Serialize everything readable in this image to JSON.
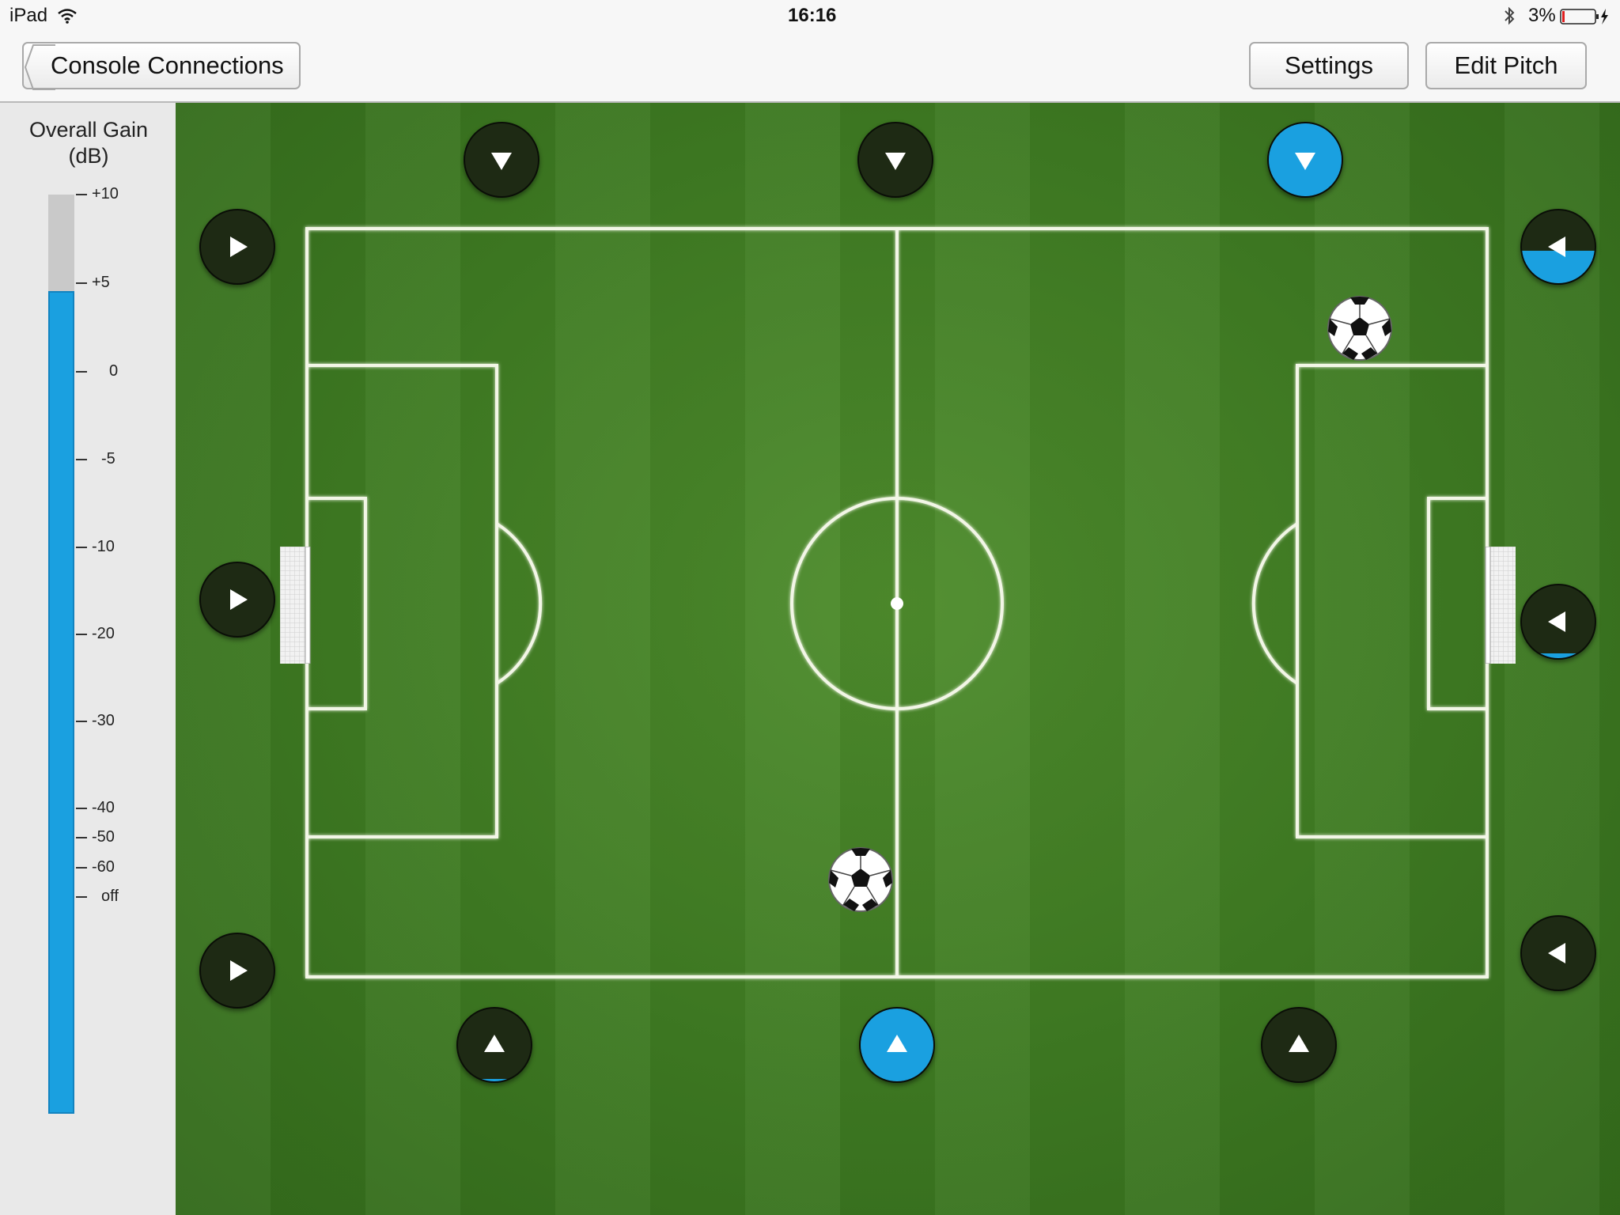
{
  "status_bar": {
    "device": "iPad",
    "time": "16:16",
    "battery": "3%"
  },
  "nav": {
    "back_label": "Console Connections",
    "settings_label": "Settings",
    "edit_pitch_label": "Edit Pitch"
  },
  "gain": {
    "title_line1": "Overall Gain",
    "title_line2": "(dB)",
    "level_fraction": 0.895,
    "ticks": [
      "+10",
      "+5",
      "0",
      "-5",
      "-10",
      "-20",
      "-30",
      "-40",
      "-50",
      "-60",
      "off"
    ]
  },
  "colors": {
    "accent": "#1aa0e0",
    "speaker": "#1e2a14",
    "pitch_grass": "#3e7a22",
    "pitch_lines": "#f2f6e6"
  },
  "speakers": {
    "top_left": {
      "icon": "triangle-down-icon",
      "level": 0.0
    },
    "top_center": {
      "icon": "triangle-down-icon",
      "level": 0.0
    },
    "top_right": {
      "icon": "triangle-down-icon",
      "level": 1.0
    },
    "left_top": {
      "icon": "triangle-right-icon",
      "level": 0.0
    },
    "left_middle": {
      "icon": "triangle-right-icon",
      "level": 0.0
    },
    "left_bottom": {
      "icon": "triangle-right-icon",
      "level": 0.0
    },
    "right_top": {
      "icon": "triangle-left-icon",
      "level": 0.45
    },
    "right_middle": {
      "icon": "triangle-left-icon",
      "level": 0.06
    },
    "right_bottom": {
      "icon": "triangle-left-icon",
      "level": 0.0
    },
    "bottom_left": {
      "icon": "triangle-up-icon",
      "level": 0.03
    },
    "bottom_center": {
      "icon": "triangle-up-icon",
      "level": 1.0
    },
    "bottom_right": {
      "icon": "triangle-up-icon",
      "level": 0.0
    }
  }
}
